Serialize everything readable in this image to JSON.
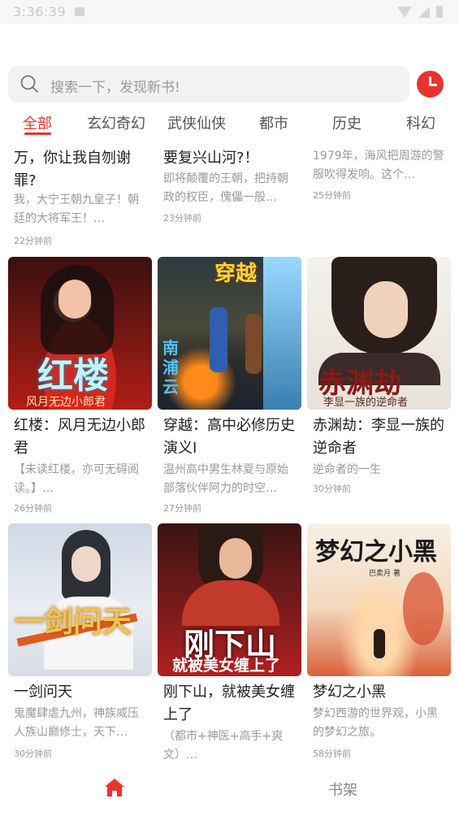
{
  "status_bar": {
    "time": "3:36:39"
  },
  "search": {
    "placeholder": "搜索一下，发现新书!"
  },
  "tabs": [
    {
      "label": "全部",
      "active": true
    },
    {
      "label": "玄幻奇幻"
    },
    {
      "label": "武侠仙侠"
    },
    {
      "label": "都市"
    },
    {
      "label": "历史"
    },
    {
      "label": "科幻"
    }
  ],
  "books": [
    {
      "title": "万，你让我自刎谢罪?",
      "desc": "我，大宁王朝九皇子！朝廷的大将军王！…",
      "time": "22分钟前"
    },
    {
      "title": "要复兴山河?！",
      "desc": "即将颠覆的王朝，把持朝政的权臣，傀儡一般…",
      "time": "23分钟前"
    },
    {
      "title": "",
      "desc": "1979年，海风把周游的警服吹得发响。这个…",
      "time": "25分钟前"
    },
    {
      "title": "红楼：风月无边小郎君",
      "desc": "【未读红楼，亦可无碍阅读。】…",
      "time": "26分钟前",
      "cover_title": "红楼",
      "cover_sub": "风月无边小郎君"
    },
    {
      "title": "穿越：高中必修历史演义I",
      "desc": "温州高中男生林夏与原始部落伙伴阿力的时空…",
      "time": "27分钟前",
      "cover_title": "穿越",
      "cover_sub": "南浦云"
    },
    {
      "title": "赤渊劫：李显一族的逆命者",
      "desc": "逆命者的一生",
      "time": "30分钟前",
      "cover_title": "赤渊劫",
      "cover_sub": "李显一族的逆命者"
    },
    {
      "title": "一剑问天",
      "desc": "鬼魔肆虐九州，神族威压人族山巅修士，天下…",
      "time": "30分钟前",
      "cover_title": "一剑问天"
    },
    {
      "title": "刚下山，就被美女缠上了",
      "desc": "（都市+神医+高手+爽文）…",
      "time": "",
      "cover_title": "刚下山",
      "cover_sub": "就被美女缠上了"
    },
    {
      "title": "梦幻之小黑",
      "desc": "梦幻西游的世界观，小黑的梦幻之旅。",
      "time": "58分钟前",
      "cover_title": "梦幻之小黑",
      "cover_sub": "巴卖月 著"
    }
  ],
  "bottom_nav": {
    "shelf_label": "书架"
  },
  "colors": {
    "accent": "#e8342e",
    "text": "#222222",
    "muted": "#9a9a9a",
    "search_bg": "#f2f2f2"
  }
}
